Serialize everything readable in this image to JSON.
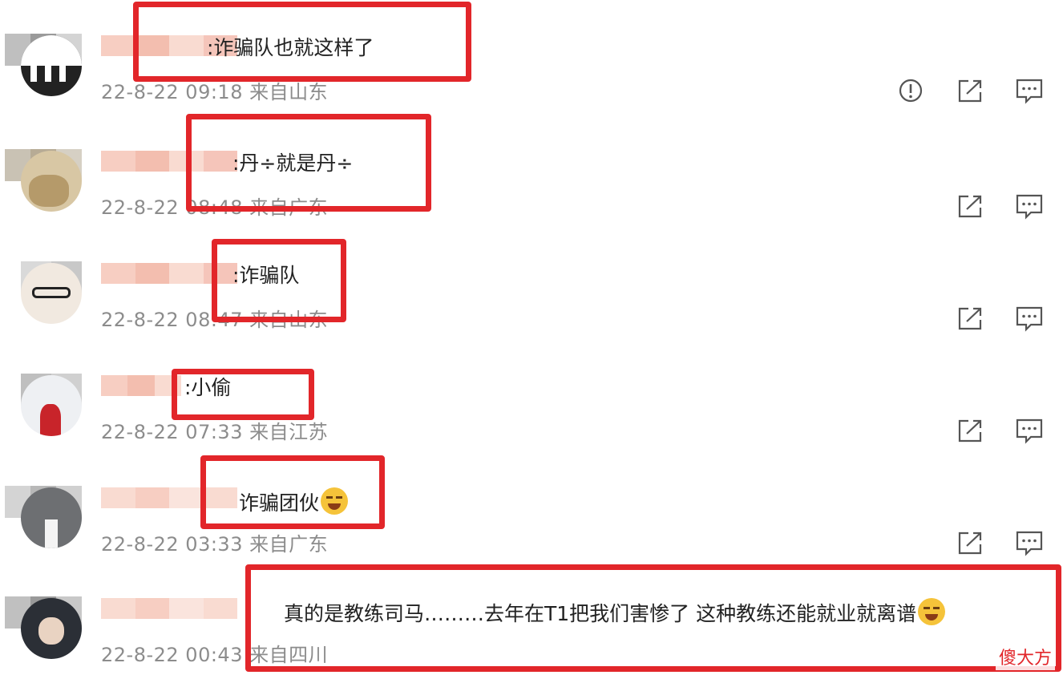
{
  "comments": [
    {
      "text": ":诈骗队也就这样了",
      "meta": "22-8-22 09:18 来自山东",
      "has_report": true
    },
    {
      "text": ":丹÷就是丹÷",
      "meta": "22-8-22 08:48 来自广东",
      "has_report": false
    },
    {
      "text": ":诈骗队",
      "meta": "22-8-22 08:47 来自山东",
      "has_report": false
    },
    {
      "text": ":小偷",
      "meta": "22-8-22 07:33 来自江苏",
      "has_report": false
    },
    {
      "text": "诈骗团伙",
      "emoji": "crying-emoji",
      "meta": "22-8-22 03:33 来自广东",
      "has_report": false
    },
    {
      "text": "真的是教练司马………去年在T1把我们害惨了  这种教练还能就业就离谱",
      "emoji": "laughing-emoji",
      "meta": "22-8-22 00:43 来自四川",
      "has_report": false
    }
  ],
  "actions": {
    "report_icon": "report-icon",
    "share_icon": "share-icon",
    "reply_icon": "comment-icon"
  },
  "watermark": {
    "brand": "傻大方"
  },
  "colors": {
    "highlight": "#e2262a",
    "meta_text": "#8c8c8c",
    "icon": "#555555"
  }
}
